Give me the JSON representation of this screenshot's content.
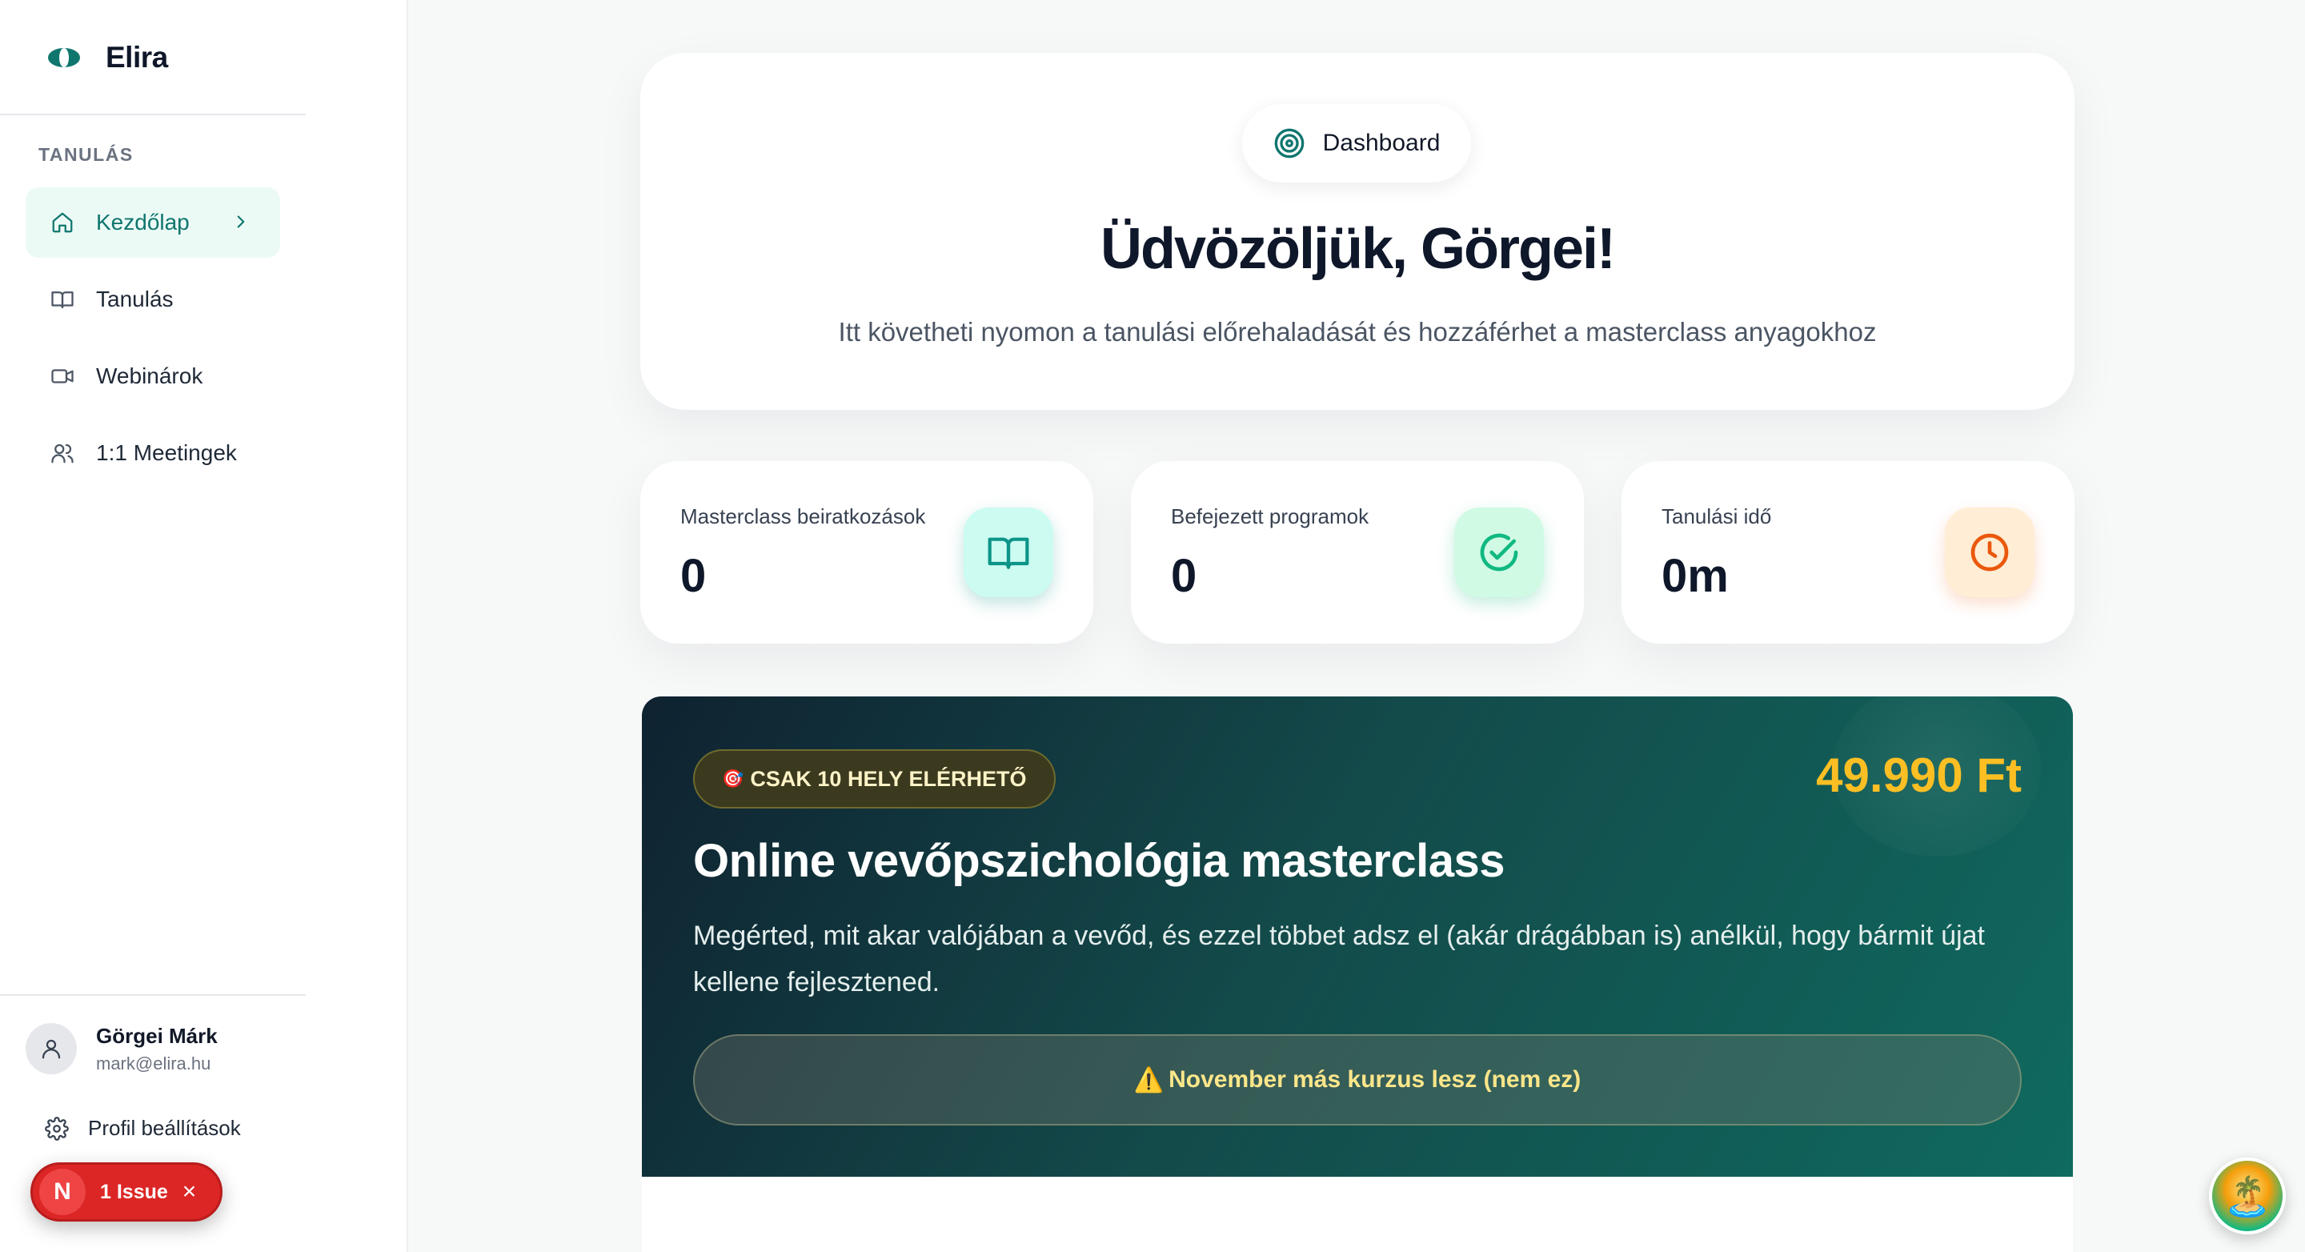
{
  "brand": {
    "name": "Elira",
    "accent": "#0f766e"
  },
  "sidebar": {
    "section_label": "TANULÁS",
    "items": [
      {
        "label": "Kezdőlap",
        "icon": "home-icon",
        "active": true
      },
      {
        "label": "Tanulás",
        "icon": "book-icon",
        "active": false
      },
      {
        "label": "Webinárok",
        "icon": "video-icon",
        "active": false
      },
      {
        "label": "1:1 Meetingek",
        "icon": "users-icon",
        "active": false
      }
    ],
    "user": {
      "name": "Görgei Márk",
      "email": "mark@elira.hu"
    },
    "profile_link": "Profil beállítások"
  },
  "issue_badge": {
    "letter": "N",
    "label": "1 Issue",
    "close": "×"
  },
  "hero": {
    "pill": "Dashboard",
    "title": "Üdvözöljük, Görgei!",
    "subtitle": "Itt követheti nyomon a tanulási előrehaladását és hozzáférhet a masterclass anyagokhoz"
  },
  "stats": [
    {
      "label": "Masterclass beiratkozások",
      "value": "0",
      "icon": "book-open-icon",
      "color": "#0d9488"
    },
    {
      "label": "Befejezett programok",
      "value": "0",
      "icon": "check-circle-icon",
      "color": "#10b981"
    },
    {
      "label": "Tanulási idő",
      "value": "0m",
      "icon": "clock-icon",
      "color": "#ea580c"
    }
  ],
  "promo": {
    "tag_emoji": "🎯",
    "tag": "CSAK 10 HELY ELÉRHETŐ",
    "price": "49.990 Ft",
    "title": "Online vevőpszichológia masterclass",
    "description": "Megérted, mit akar valójában a vevőd, és ezzel többet adsz el (akár drágábban is) anélkül, hogy bármit újat kellene fejlesztened.",
    "notice_icon": "⚠️",
    "notice": "November más kurzus lesz (nem ez)"
  },
  "fab": {
    "emoji": "🏝️"
  }
}
